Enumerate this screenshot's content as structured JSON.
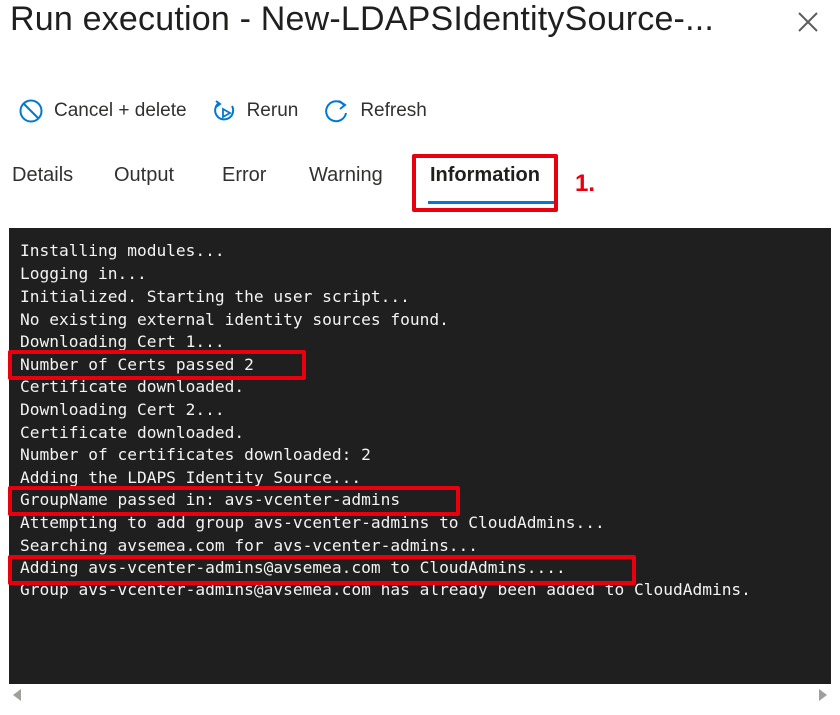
{
  "header": {
    "title": "Run execution - New-LDAPSIdentitySource-..."
  },
  "toolbar": {
    "cancel_label": "Cancel + delete",
    "rerun_label": "Rerun",
    "refresh_label": "Refresh"
  },
  "tabs": [
    {
      "label": "Details",
      "active": false
    },
    {
      "label": "Output",
      "active": false
    },
    {
      "label": "Error",
      "active": false
    },
    {
      "label": "Warning",
      "active": false
    },
    {
      "label": "Information",
      "active": true
    }
  ],
  "annotation": {
    "step_label": "1.",
    "color": "#e8000f"
  },
  "console": {
    "lines": [
      "Installing modules...",
      "Logging in...",
      "Initialized. Starting the user script...",
      "No existing external identity sources found.",
      "Downloading Cert 1...",
      "Number of Certs passed 2",
      "Certificate downloaded.",
      "Downloading Cert 2...",
      "Certificate downloaded.",
      "Number of certificates downloaded: 2",
      "Adding the LDAPS Identity Source...",
      "GroupName passed in: avs-vcenter-admins",
      "Attempting to add group avs-vcenter-admins to CloudAdmins...",
      "Searching avsemea.com for avs-vcenter-admins...",
      "Adding avs-vcenter-admins@avsemea.com to CloudAdmins....",
      "Group avs-vcenter-admins@avsemea.com has already been added to CloudAdmins."
    ],
    "highlighted_lines": [
      5,
      11,
      14
    ]
  },
  "colors": {
    "accent": "#0078d4",
    "console_bg": "#1f1f1f",
    "console_text": "#f3f3f3",
    "highlight": "#e8000f"
  },
  "icons": {
    "cancel": "cancel-circle-icon",
    "rerun": "rerun-icon",
    "refresh": "refresh-icon",
    "close": "close-icon"
  }
}
